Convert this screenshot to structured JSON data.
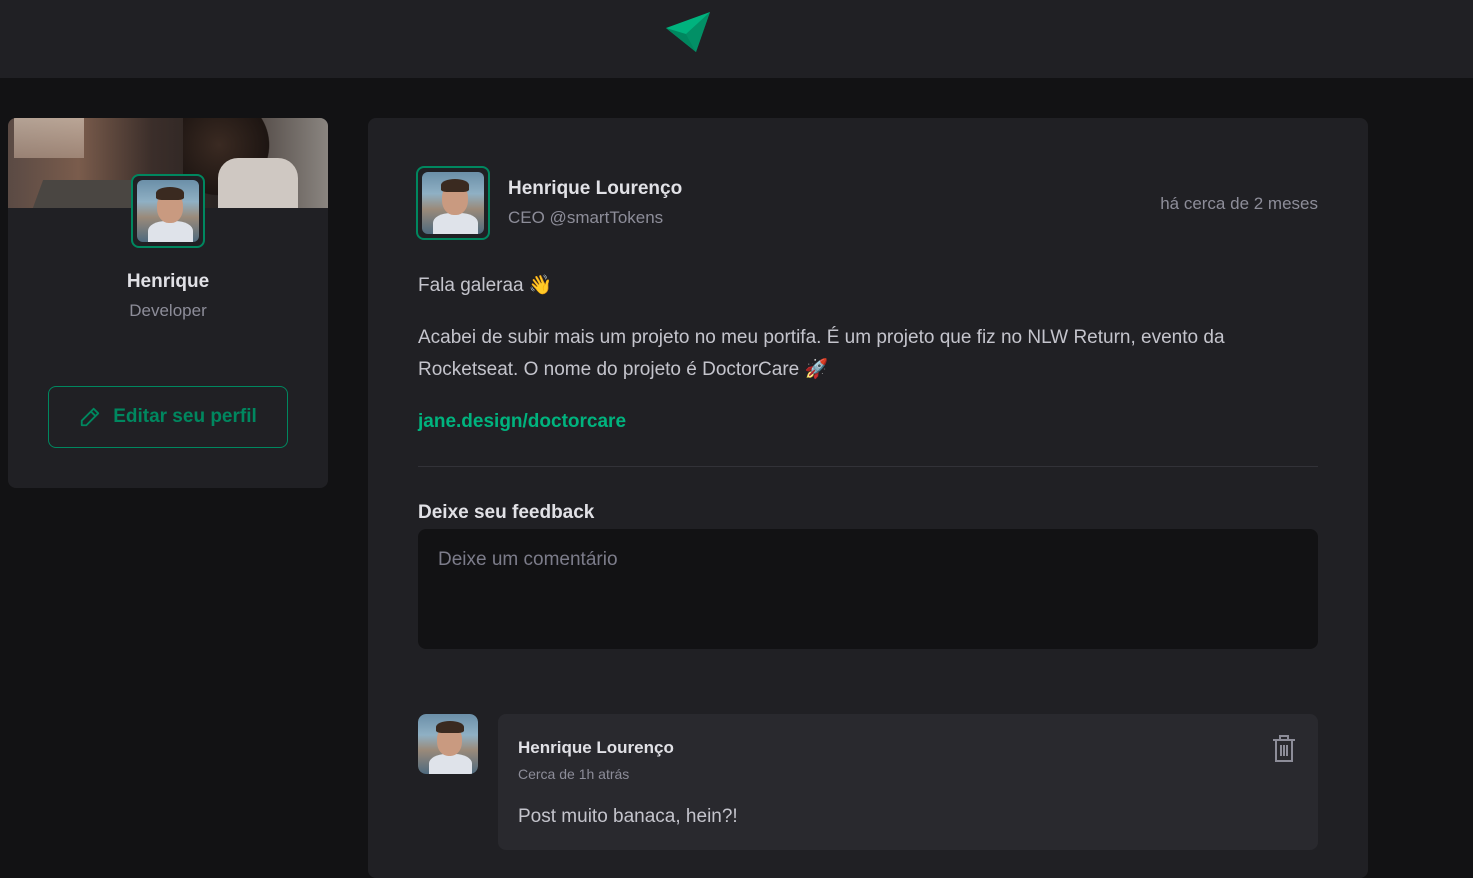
{
  "header": {
    "logo_icon": "ignite-feed-logo-icon"
  },
  "sidebar": {
    "name": "Henrique",
    "role": "Developer",
    "edit_button_label": "Editar seu perfil"
  },
  "post": {
    "author_name": "Henrique Lourenço",
    "author_role": "CEO @smartTokens",
    "time": "há cerca de 2 meses",
    "paragraph_1": "Fala galeraa 👋",
    "paragraph_2": "Acabei de subir mais um projeto no meu portifa. É um projeto que fiz no NLW Return, evento da Rocketseat. O nome do projeto é DoctorCare 🚀",
    "link": "jane.design/doctorcare",
    "feedback_title": "Deixe seu feedback",
    "comment_placeholder": "Deixe um comentário"
  },
  "comment": {
    "author": "Henrique Lourenço",
    "time": "Cerca de 1h atrás",
    "text": "Post muito banaca, hein?!"
  },
  "colors": {
    "accent": "#00875f",
    "link": "#00b37e",
    "background": "#121214",
    "card": "#202024"
  }
}
